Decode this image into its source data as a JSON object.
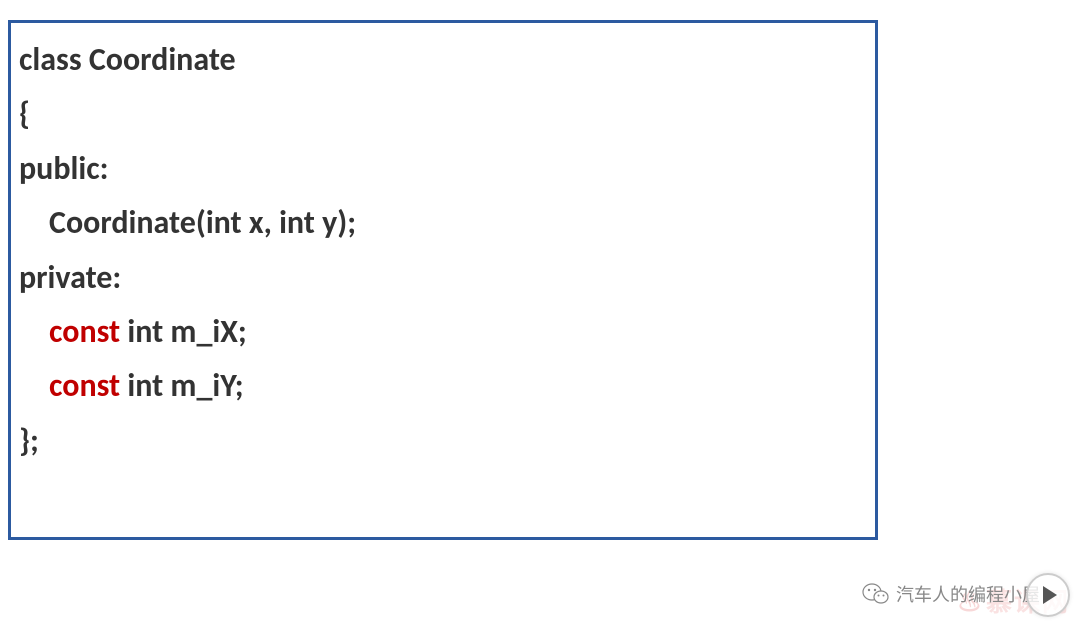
{
  "code": {
    "line1": "class Coordinate",
    "line2": "{",
    "line3": "public:",
    "line4": "Coordinate(int x, int y);",
    "line5": "private:",
    "line6_const": "const",
    "line6_rest": " int m_iX;",
    "line7_const": "const",
    "line7_rest": " int m_iY;",
    "line8": "};"
  },
  "watermark": {
    "wechat_text": "汽车人的编程小屋",
    "bg_text": "慕课网"
  }
}
